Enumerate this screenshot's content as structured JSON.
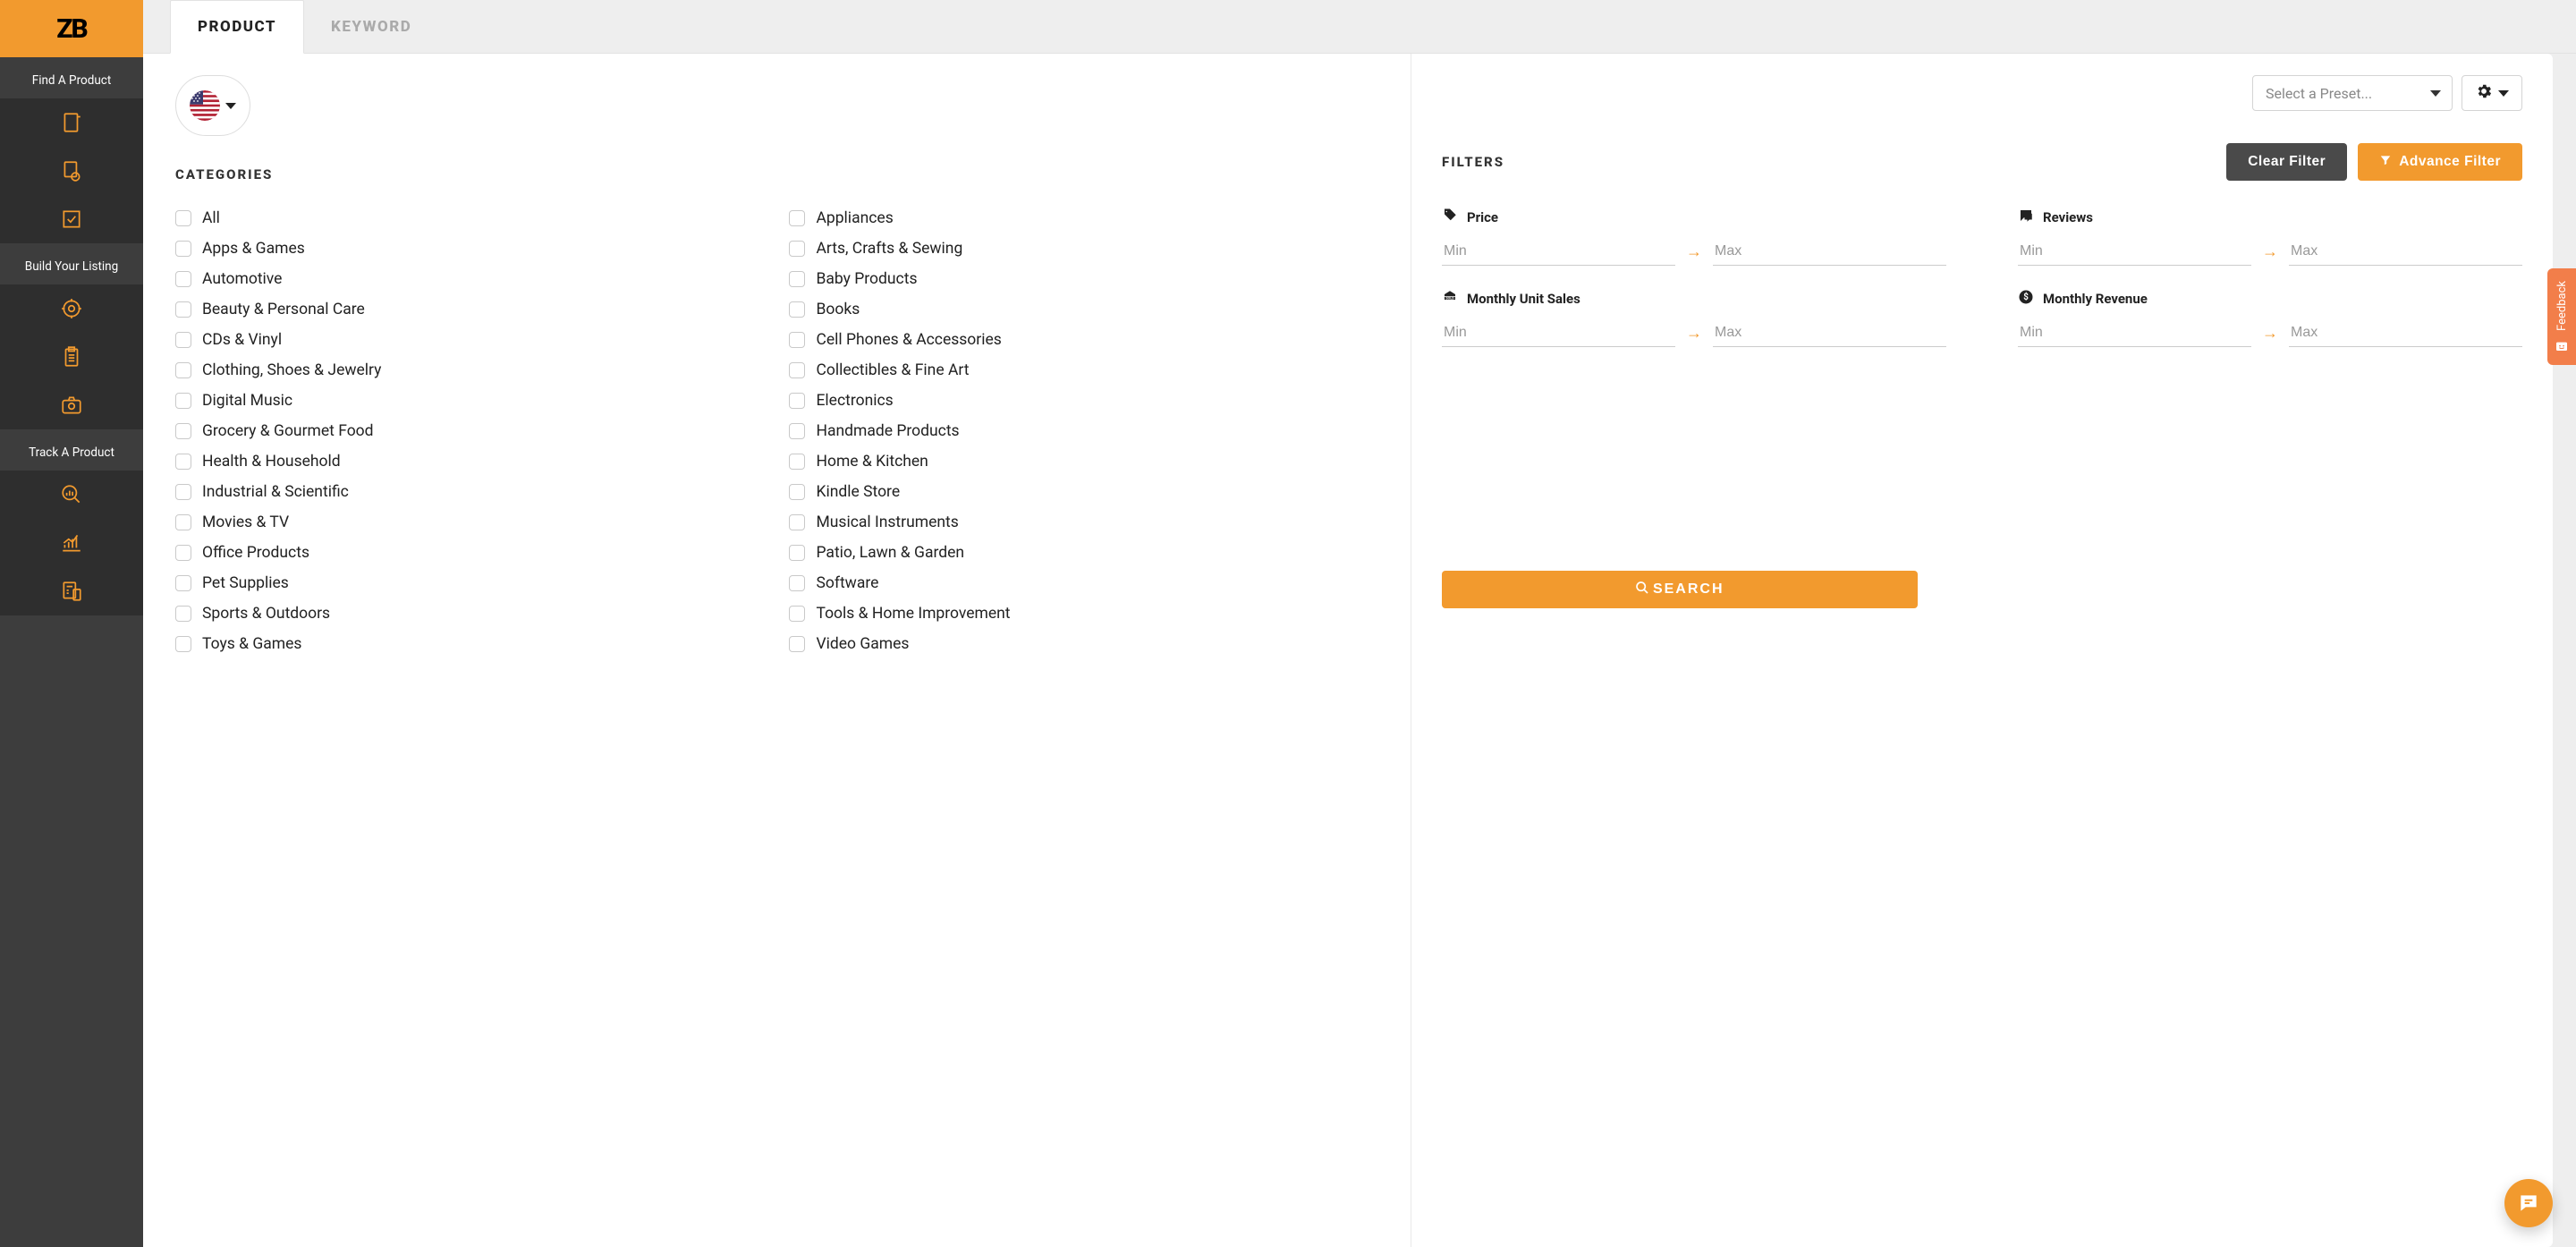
{
  "logo": "ZB",
  "sidebar": {
    "sections": [
      {
        "label": "Find A Product"
      },
      {
        "label": "Build Your Listing"
      },
      {
        "label": "Track A Product"
      }
    ]
  },
  "tabs": {
    "product": "PRODUCT",
    "keyword": "KEYWORD"
  },
  "categories_header": "CATEGORIES",
  "categories": [
    "All",
    "Appliances",
    "Apps & Games",
    "Arts, Crafts & Sewing",
    "Automotive",
    "Baby Products",
    "Beauty & Personal Care",
    "Books",
    "CDs & Vinyl",
    "Cell Phones & Accessories",
    "Clothing, Shoes & Jewelry",
    "Collectibles & Fine Art",
    "Digital Music",
    "Electronics",
    "Grocery & Gourmet Food",
    "Handmade Products",
    "Health & Household",
    "Home & Kitchen",
    "Industrial & Scientific",
    "Kindle Store",
    "Movies & TV",
    "Musical Instruments",
    "Office Products",
    "Patio, Lawn & Garden",
    "Pet Supplies",
    "Software",
    "Sports & Outdoors",
    "Tools & Home Improvement",
    "Toys & Games",
    "Video Games"
  ],
  "preset_placeholder": "Select a Preset...",
  "filters_header": "FILTERS",
  "buttons": {
    "clear": "Clear Filter",
    "advance": "Advance Filter",
    "search": "SEARCH"
  },
  "filters": {
    "price_label": "Price",
    "reviews_label": "Reviews",
    "sales_label": "Monthly Unit Sales",
    "revenue_label": "Monthly Revenue",
    "min_placeholder": "Min",
    "max_placeholder": "Max"
  },
  "feedback_label": "Feedback"
}
